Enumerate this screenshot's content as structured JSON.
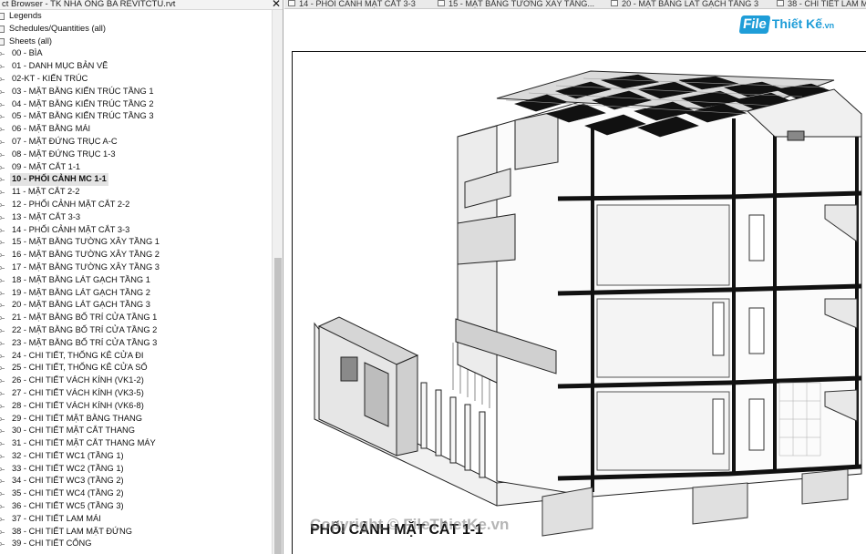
{
  "project_browser": {
    "title": "ct Browser - TK NHÀ ỐNG BA REVITCTU.rvt",
    "close_glyph": "✕",
    "categories": [
      "Legends",
      "Schedules/Quantities (all)",
      "Sheets (all)"
    ],
    "sheets": [
      "00 - BÌA",
      "01 - DANH MỤC BẢN VẼ",
      "02-KT - KIẾN TRÚC",
      "03 - MẶT BẰNG KIẾN TRÚC TẦNG 1",
      "04 - MẶT BẰNG KIẾN TRÚC TẦNG 2",
      "05 - MẶT BẰNG KIẾN TRÚC TẦNG 3",
      "06 - MẶT BẰNG MÁI",
      "07 - MẶT ĐỨNG TRỤC A-C",
      "08 - MẶT ĐỨNG TRỤC 1-3",
      "09 - MẶT CẮT 1-1",
      "10 - PHỐI CẢNH MC 1-1",
      "11 - MẶT CẮT 2-2",
      "12 - PHỐI CẢNH MẶT CẮT 2-2",
      "13 - MẶT CẮT 3-3",
      "14 - PHỐI CẢNH MẶT CẮT 3-3",
      "15 - MẶT BẰNG TƯỜNG XÂY TẦNG 1",
      "16 - MẶT BẰNG TƯỜNG XÂY TẦNG 2",
      "17 - MẶT BẰNG TƯỜNG XÂY TẦNG 3",
      "18 - MẶT BẰNG LÁT GẠCH TẦNG 1",
      "19 - MẶT BẰNG LÁT GẠCH TẦNG 2",
      "20 - MẶT BẰNG LÁT GẠCH TẦNG 3",
      "21 - MẶT BẰNG BỐ TRÍ CỬA TẦNG 1",
      "22 - MẶT BẰNG BỐ TRÍ CỬA TẦNG 2",
      "23 - MẶT BẰNG BỐ TRÍ CỬA TẦNG 3",
      "24 - CHI TIẾT, THỐNG KÊ CỬA ĐI",
      "25 - CHI TIẾT, THỐNG KÊ CỬA SỔ",
      "26 - CHI TIẾT VÁCH KÍNH (VK1-2)",
      "27 - CHI TIẾT VÁCH KÍNH (VK3-5)",
      "28 - CHI TIẾT VÁCH KÍNH (VK6-8)",
      "29 - CHI TIẾT MẶT BẰNG THANG",
      "30 - CHI TIẾT MẶT CẮT THANG",
      "31 - CHI TIẾT MẶT CẮT THANG MÁY",
      "32 - CHI TIẾT WC1 (TẦNG 1)",
      "33 - CHI TIẾT WC2 (TẦNG 1)",
      "34 - CHI TIẾT WC3 (TẦNG 2)",
      "35 - CHI TIẾT WC4 (TẦNG 2)",
      "36 - CHI TIẾT WC5 (TẦNG 3)",
      "37 - CHI TIẾT LAM MÁI",
      "38 - CHI TIẾT LAM MẶT ĐỨNG",
      "39 - CHI TIẾT CỔNG"
    ],
    "selected_index": 10
  },
  "view_tabs": [
    "14 - PHỐI CẢNH MẶT CẮT 3-3",
    "15 - MẶT BẰNG TƯỜNG XÂY TẦNG...",
    "20 - MẶT BẰNG LÁT GẠCH TẦNG 3",
    "38 - CHI TIẾT LAM M"
  ],
  "canvas": {
    "view_title": "PHỐI CẢNH MẶT CẮT 1-1",
    "watermark": "Copyright © FileThietKe.vn",
    "logo": {
      "part1": "File",
      "part2": "Thiết Kế",
      "part3": ".vn",
      "color": "#1e9dd8"
    }
  }
}
